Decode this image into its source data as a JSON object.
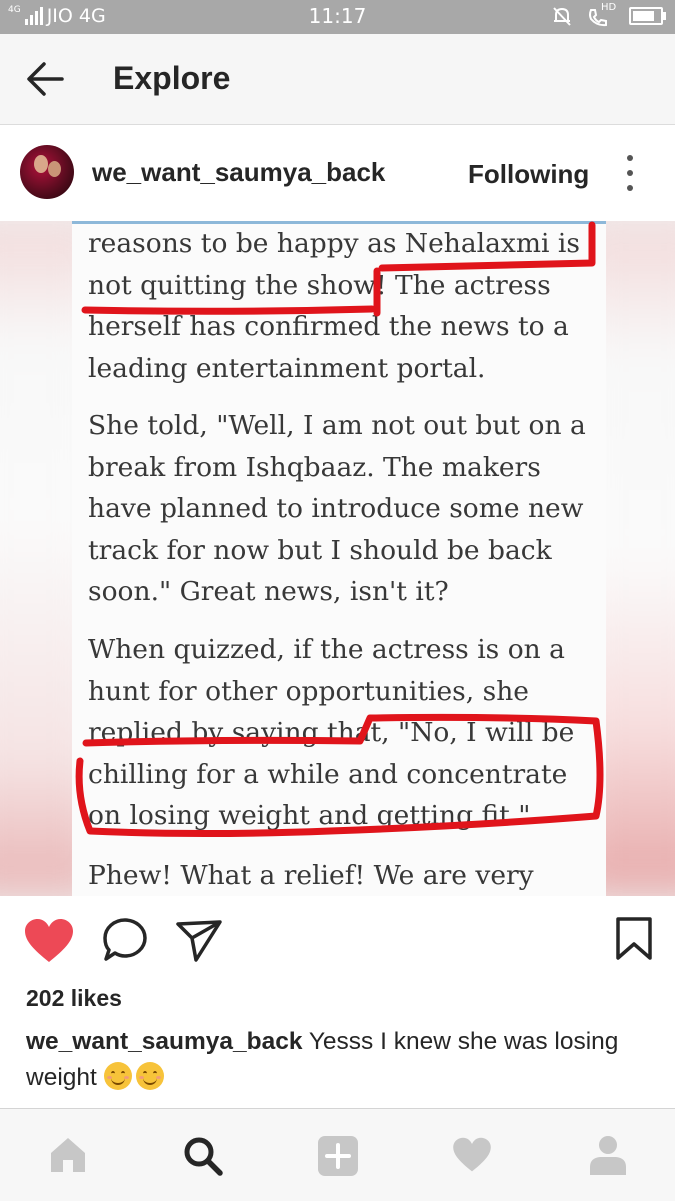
{
  "status_bar": {
    "network_small": "4G",
    "carrier": "JIO 4G",
    "time": "11:17",
    "hd_badge": "HD",
    "icons": [
      "signal-icon",
      "mute-bell-icon",
      "hd-call-icon",
      "battery-icon"
    ]
  },
  "top_bar": {
    "title": "Explore",
    "back_icon": "arrow-left-icon"
  },
  "post_header": {
    "username": "we_want_saumya_back",
    "follow_state": "Following",
    "more_icon": "more-vertical-icon"
  },
  "post_image": {
    "article_paragraphs": [
      "reasons to be happy as Nehalaxmi is\nnot quitting the show! The actress\nherself has confirmed the news to a\nleading entertainment portal.",
      "She told, \"Well, I am not out but on a\nbreak from Ishqbaaz. The makers\nhave planned to introduce some new\ntrack for now but I should be back\nsoon.\" Great news, isn't it?",
      "When quizzed, if the actress is on a\nhunt for other opportunities, she\nreplied by saying that, \"No, I will be\nchilling for a while and concentrate\non losing weight and getting fit.\"",
      "Phew! What a relief! We are very sure"
    ],
    "highlight_color": "#e0141b"
  },
  "actions": {
    "icons": [
      "heart-filled-icon",
      "comment-icon",
      "share-icon",
      "bookmark-icon"
    ],
    "liked_color": "#ed4956"
  },
  "likes": "202 likes",
  "caption": {
    "username": "we_want_saumya_back",
    "text": "Yesss I knew she was losing weight"
  },
  "bottom_nav": {
    "icons": [
      "home-icon",
      "search-icon",
      "add-post-icon",
      "activity-heart-icon",
      "profile-icon"
    ],
    "active": "search-icon"
  }
}
